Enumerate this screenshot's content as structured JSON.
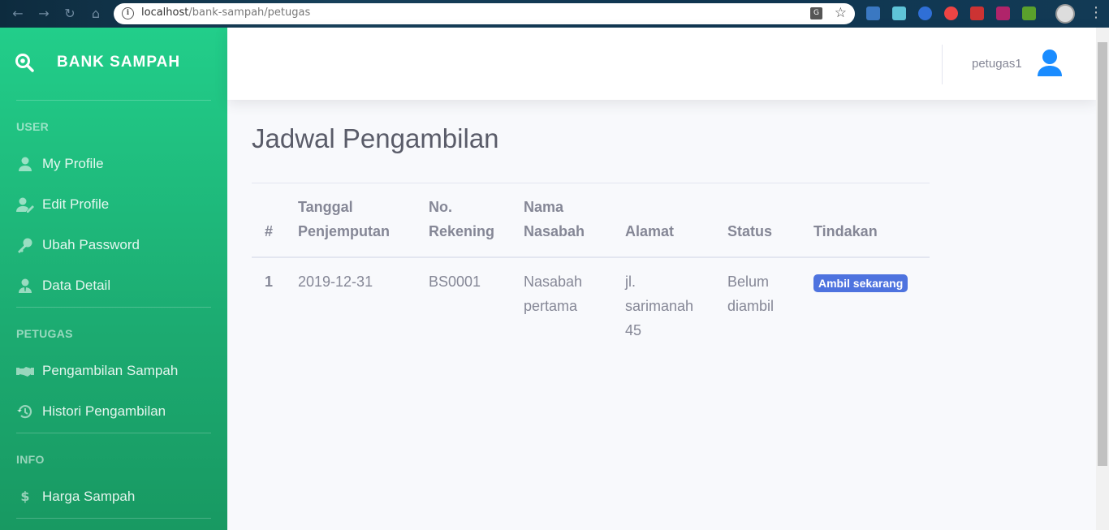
{
  "browser": {
    "url_host": "localhost",
    "url_path": "/bank-sampah/petugas"
  },
  "sidebar": {
    "brand": "BANK SAMPAH",
    "sections": [
      {
        "heading": "USER",
        "items": [
          {
            "label": "My Profile",
            "icon": "user-icon"
          },
          {
            "label": "Edit Profile",
            "icon": "user-edit-icon"
          },
          {
            "label": "Ubah Password",
            "icon": "key-icon"
          },
          {
            "label": "Data Detail",
            "icon": "user-tie-icon"
          }
        ]
      },
      {
        "heading": "PETUGAS",
        "items": [
          {
            "label": "Pengambilan Sampah",
            "icon": "handshake-icon"
          },
          {
            "label": "Histori Pengambilan",
            "icon": "history-icon"
          }
        ]
      },
      {
        "heading": "INFO",
        "items": [
          {
            "label": "Harga Sampah",
            "icon": "dollar-icon"
          }
        ]
      }
    ]
  },
  "topbar": {
    "username": "petugas1"
  },
  "main": {
    "title": "Jadwal Pengambilan",
    "table": {
      "headers": {
        "num": "#",
        "tanggal_1": "Tanggal",
        "tanggal_2": "Penjemputan",
        "rekening_1": "No.",
        "rekening_2": "Rekening",
        "nama_1": "Nama",
        "nama_2": "Nasabah",
        "alamat": "Alamat",
        "status": "Status",
        "tindakan": "Tindakan"
      },
      "rows": [
        {
          "num": "1",
          "tanggal": "2019-12-31",
          "rekening": "BS0001",
          "nama_1": "Nasabah",
          "nama_2": "pertama",
          "alamat_1": "jl.",
          "alamat_2": "sarimanah",
          "alamat_3": "45",
          "status_1": "Belum",
          "status_2": "diambil",
          "action": "Ambil sekarang"
        }
      ]
    }
  },
  "colors": {
    "sidebar_top": "#22ce8a",
    "sidebar_bottom": "#189962",
    "primary": "#4e73df",
    "text_gray": "#858796"
  }
}
